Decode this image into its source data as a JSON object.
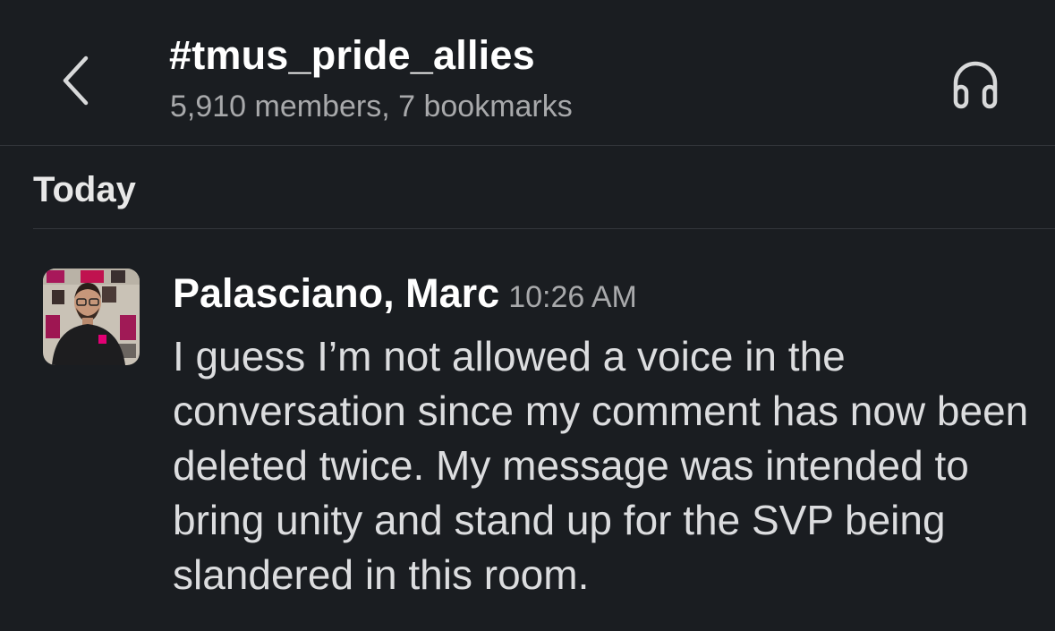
{
  "header": {
    "channel_name": "#tmus_pride_allies",
    "meta": "5,910 members, 7 bookmarks",
    "back_icon": "chevron-left-icon",
    "huddle_icon": "headphones-icon"
  },
  "timeline": {
    "day_label": "Today"
  },
  "message": {
    "author": "Palasciano, Marc",
    "time": "10:26 AM",
    "text": "I guess I’m not allowed a voice in the conversation since my comment has now been deleted twice. My message was intended to bring unity and stand up for the SVP being slandered in this room."
  },
  "colors": {
    "background": "#1a1d21",
    "divider": "#33363b",
    "primary_text": "#ffffff",
    "secondary_text": "#a8a9ab",
    "brand_magenta": "#e20074"
  }
}
